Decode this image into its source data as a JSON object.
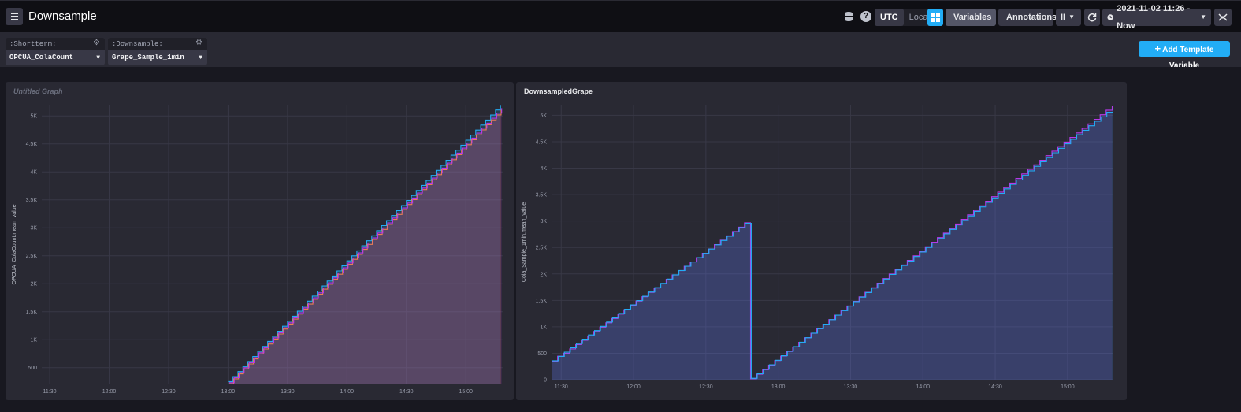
{
  "header": {
    "title": "Downsample",
    "timezone": {
      "utc": "UTC",
      "local": "Local",
      "selected": "UTC"
    },
    "variables_label": "Variables",
    "annotations_label": "Annotations",
    "pause_glyph": "II",
    "time_range": "2021-11-02 11:26 - Now",
    "icons": [
      "menu-icon",
      "database-icon",
      "help-icon",
      "dashboard-icon",
      "cube-icon",
      "pin-icon",
      "pause-icon",
      "refresh-icon",
      "clock-icon",
      "fullscreen-icon"
    ],
    "accent_color": "#22adf6"
  },
  "template_variables": [
    {
      "name": ":Shortterm:",
      "value": "OPCUA_ColaCount"
    },
    {
      "name": ":Downsample:",
      "value": "Grape_Sample_1min"
    }
  ],
  "add_template_variable_label": "Add Template Variable",
  "cells": [
    {
      "title": "Untitled Graph",
      "chart_data": {
        "type": "line",
        "ylabel": "OPCUA_ColaCount.mean_value",
        "x_ticks": [
          "11:30",
          "12:00",
          "12:30",
          "13:00",
          "13:30",
          "14:00",
          "14:30",
          "15:00"
        ],
        "x_range": [
          "11:26",
          "15:19"
        ],
        "y_ticks": [
          "500",
          "1K",
          "1.5K",
          "2K",
          "2.5K",
          "3K",
          "3.5K",
          "4K",
          "4.5K",
          "5K"
        ],
        "y_range": [
          200,
          5200
        ],
        "series": [
          {
            "color": "#22adf6",
            "x": [
              "13:00",
              "15:19"
            ],
            "y": [
              250,
              5250
            ]
          },
          {
            "color": "#f48d38",
            "x": [
              "13:00",
              "15:19"
            ],
            "y": [
              200,
              5150
            ]
          },
          {
            "color": "#b63ae9",
            "x": [
              "13:00",
              "15:19"
            ],
            "y": [
              210,
              5170
            ]
          }
        ]
      }
    },
    {
      "title": "DownsampledGrape",
      "chart_data": {
        "type": "line",
        "ylabel": "Cola_Sample_1min.mean_value",
        "x_ticks": [
          "11:30",
          "12:00",
          "12:30",
          "13:00",
          "13:30",
          "14:00",
          "14:30",
          "15:00"
        ],
        "x_range": [
          "11:26",
          "15:19"
        ],
        "y_ticks": [
          "0",
          "500",
          "1K",
          "1.5K",
          "2K",
          "2.5K",
          "3K",
          "3.5K",
          "4K",
          "4.5K",
          "5K"
        ],
        "y_range": [
          0,
          5200
        ],
        "series": [
          {
            "color": "#b63ae9",
            "x": [
              "11:26",
              "11:30",
              "11:31",
              "12:47",
              "12:48",
              "15:19"
            ],
            "y": [
              350,
              500,
              500,
              3000,
              0,
              5200
            ]
          },
          {
            "color": "#22adf6",
            "x": [
              "11:26",
              "12:47",
              "12:48",
              "15:19"
            ],
            "y": [
              350,
              2980,
              0,
              5150
            ]
          }
        ]
      }
    }
  ]
}
